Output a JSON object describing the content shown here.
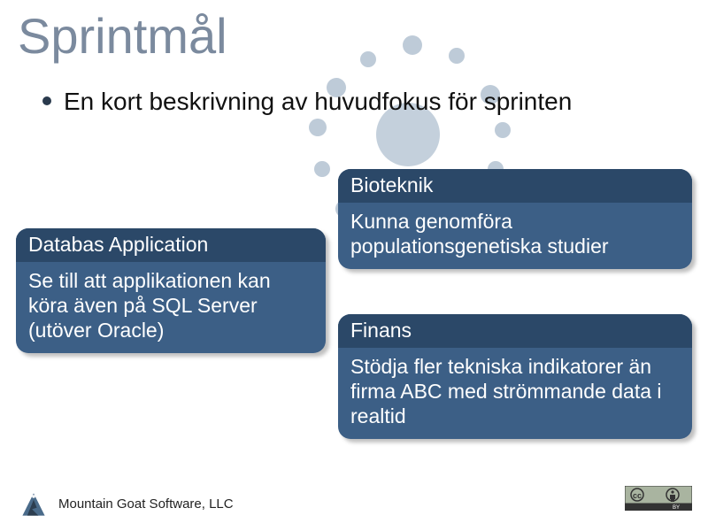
{
  "title": "Sprintmål",
  "bullet": "En kort beskrivning av huvudfokus för sprinten",
  "cards": {
    "left": {
      "header": "Databas Application",
      "body": "Se till att applikationen kan köra även på SQL Server (utöver Oracle)"
    },
    "top": {
      "header": "Bioteknik",
      "body": "Kunna genomföra populationsgenetiska studier"
    },
    "bot": {
      "header": "Finans",
      "body": "Stödja fler tekniska indikatorer än firma ABC med strömmande data i realtid"
    }
  },
  "footer": {
    "company": "Mountain Goat Software, LLC",
    "cc_label": "BY"
  }
}
